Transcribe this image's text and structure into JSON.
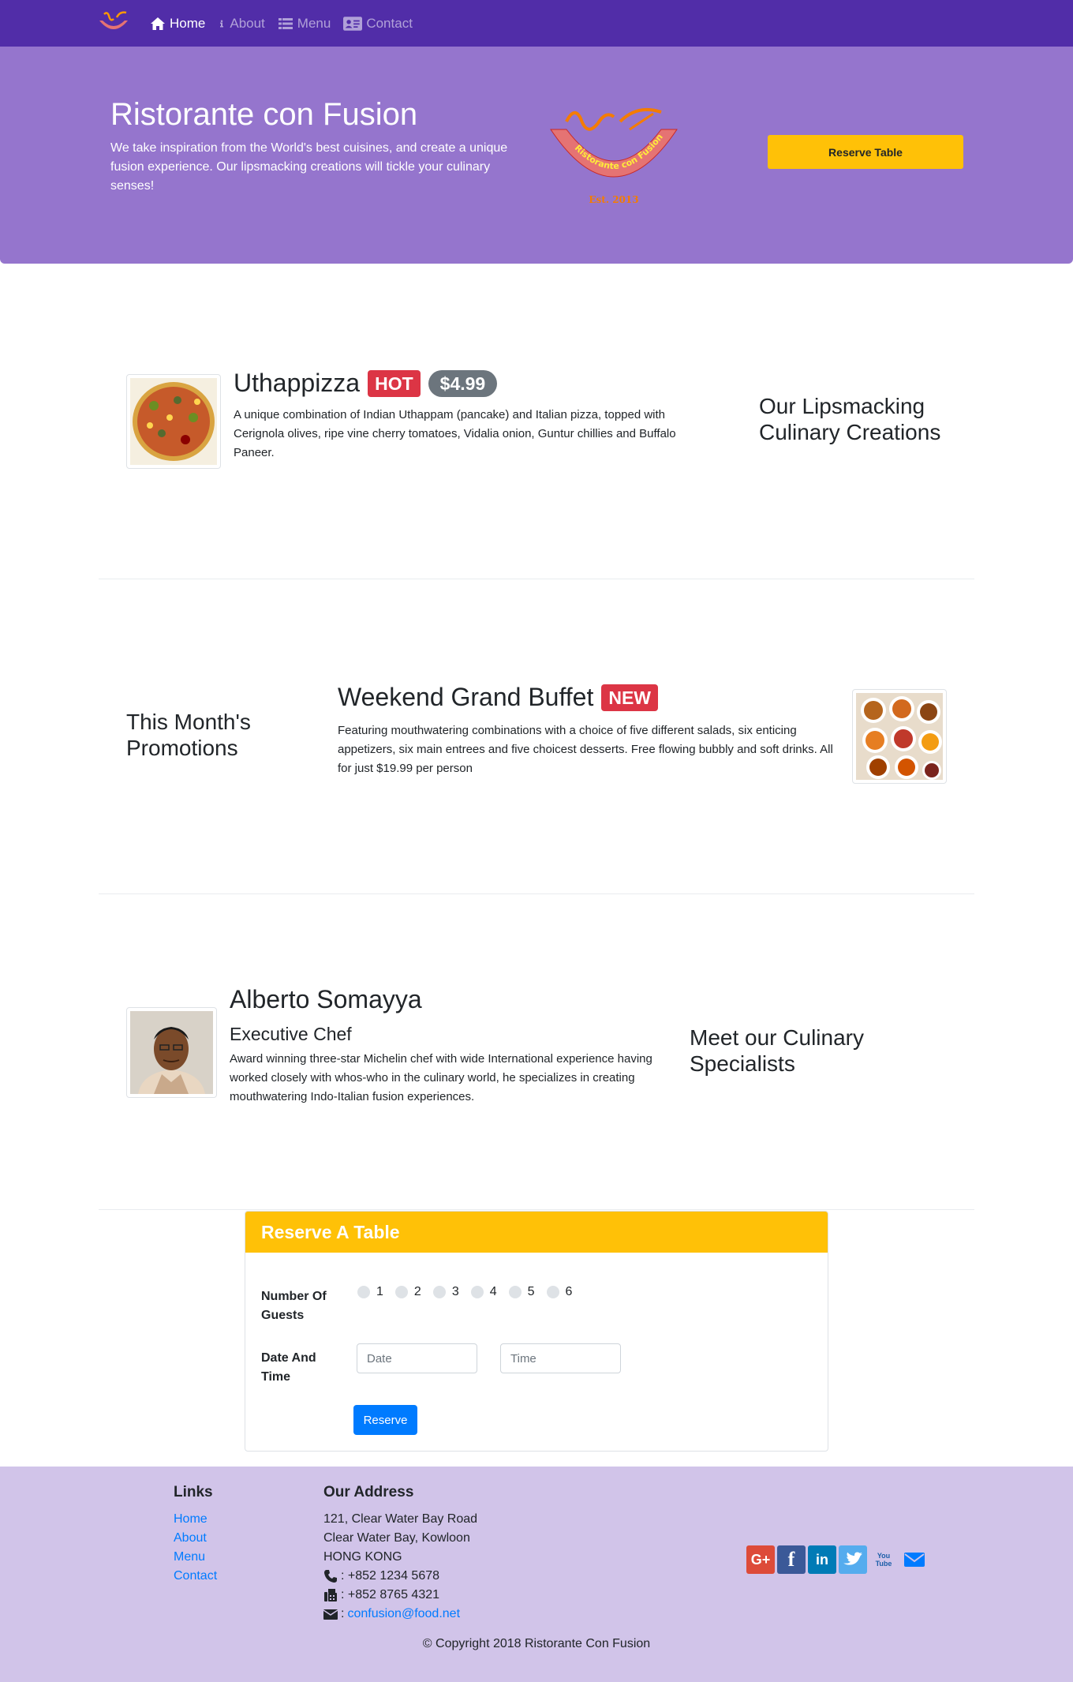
{
  "nav": {
    "items": [
      {
        "label": "Home",
        "icon": "home-icon",
        "active": true
      },
      {
        "label": "About",
        "icon": "info-icon"
      },
      {
        "label": "Menu",
        "icon": "list-icon"
      },
      {
        "label": "Contact",
        "icon": "address-card-icon"
      }
    ]
  },
  "jumbotron": {
    "title": "Ristorante con Fusion",
    "text": "We take inspiration from the World's best cuisines, and create a unique fusion experience. Our lipsmacking creations will tickle your culinary senses!",
    "logo_text": "Ristorante con Fusion",
    "logo_est": "Est. 2013",
    "reserve_label": "Reserve Table"
  },
  "dish": {
    "name": "Uthappizza",
    "badge": "HOT",
    "price": "$4.99",
    "description": "A unique combination of Indian Uthappam (pancake) and Italian pizza, topped with Cerignola olives, ripe vine cherry tomatoes, Vidalia onion, Guntur chillies and Buffalo Paneer.",
    "section_title": "Our Lipsmacking Culinary Creations"
  },
  "promotion": {
    "section_title": "This Month's Promotions",
    "name": "Weekend Grand Buffet",
    "badge": "NEW",
    "description": "Featuring mouthwatering combinations with a choice of five different salads, six enticing appetizers, six main entrees and five choicest desserts. Free flowing bubbly and soft drinks. All for just $19.99 per person"
  },
  "leader": {
    "name": "Alberto Somayya",
    "designation": "Executive Chef",
    "description": "Award winning three-star Michelin chef with wide International experience having worked closely with whos-who in the culinary world, he specializes in creating mouthwatering Indo-Italian fusion experiences.",
    "section_title": "Meet our Culinary Specialists"
  },
  "reservation": {
    "title": "Reserve A Table",
    "guests_label": "Number Of Guests",
    "guest_options": [
      "1",
      "2",
      "3",
      "4",
      "5",
      "6"
    ],
    "datetime_label": "Date And Time",
    "date_placeholder": "Date",
    "time_placeholder": "Time",
    "submit_label": "Reserve"
  },
  "footer": {
    "links_heading": "Links",
    "links": [
      "Home",
      "About",
      "Menu",
      "Contact"
    ],
    "address_heading": "Our Address",
    "address_lines": [
      "121, Clear Water Bay Road",
      "Clear Water Bay, Kowloon",
      "HONG KONG"
    ],
    "phone": ": +852 1234 5678",
    "fax": ": +852 8765 4321",
    "email_prefix": ": ",
    "email": "confusion@food.net",
    "social": [
      {
        "name": "google-plus-icon",
        "label": "G+",
        "color": "#dd4b39"
      },
      {
        "name": "facebook-icon",
        "label": "f",
        "color": "#3b5998"
      },
      {
        "name": "linkedin-icon",
        "label": "in",
        "color": "#007bb6"
      },
      {
        "name": "twitter-icon",
        "label": "",
        "color": "#55acee"
      },
      {
        "name": "youtube-icon",
        "label": "You Tube",
        "color": "#bb0000"
      },
      {
        "name": "mail-icon",
        "label": "",
        "color": "#007bff"
      }
    ],
    "copyright": "© Copyright 2018 Ristorante Con Fusion"
  }
}
